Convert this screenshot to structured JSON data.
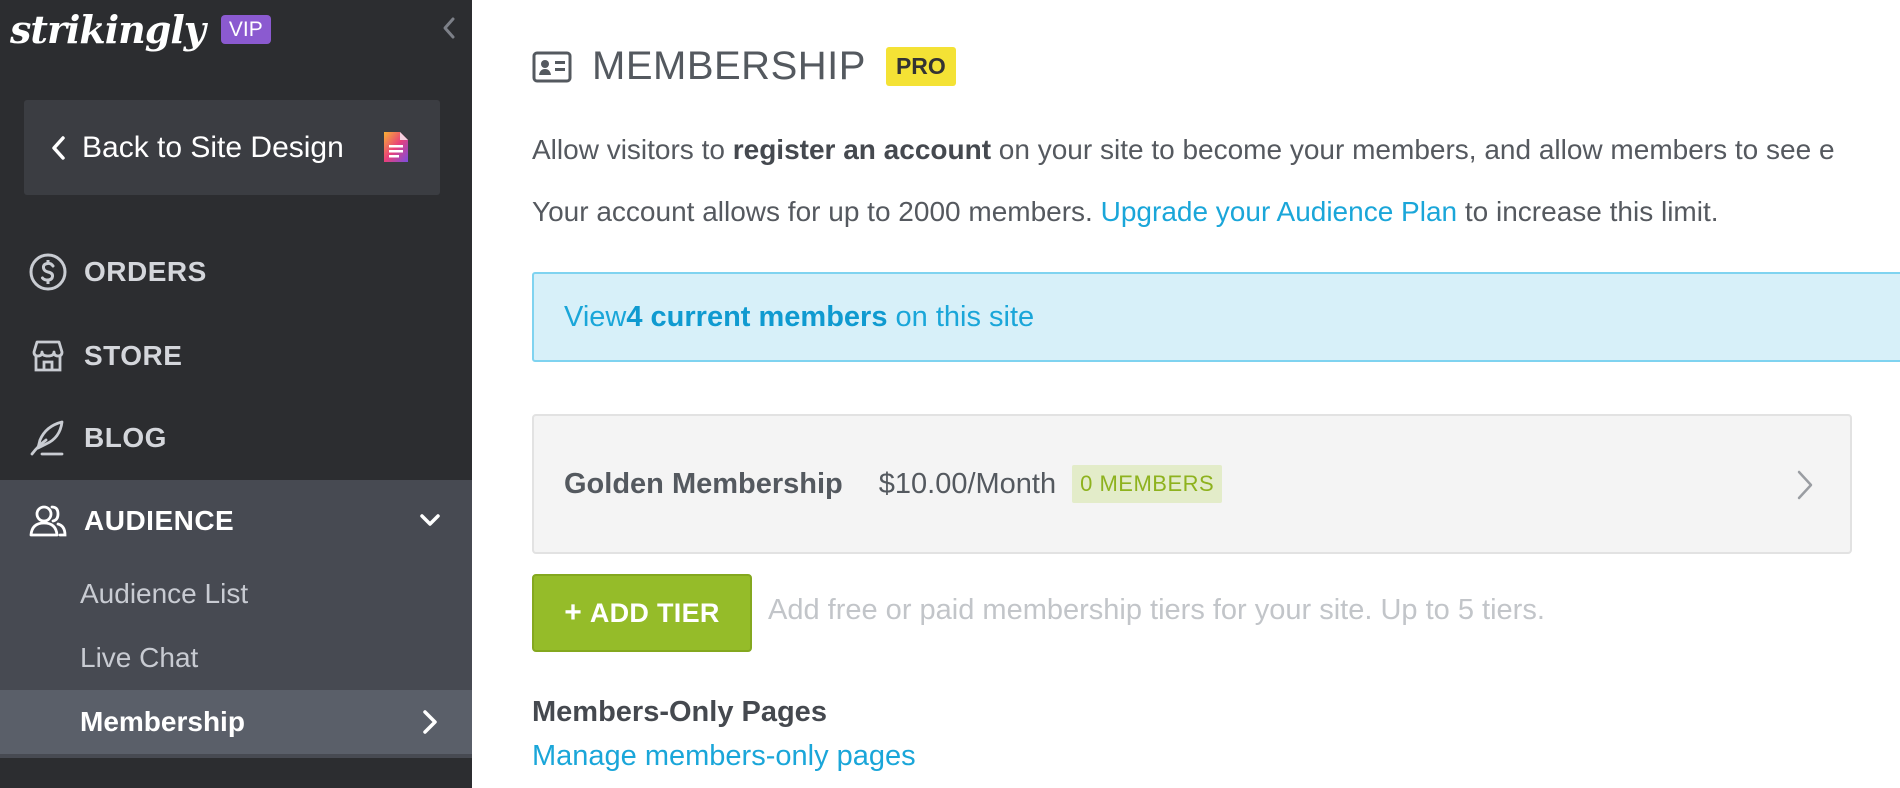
{
  "sidebar": {
    "logo": "strikingly",
    "vip": "VIP",
    "back_label": "Back to Site Design",
    "nav": [
      {
        "label": "ORDERS",
        "icon": "dollar-circle-icon"
      },
      {
        "label": "STORE",
        "icon": "storefront-icon"
      },
      {
        "label": "BLOG",
        "icon": "quill-icon"
      },
      {
        "label": "AUDIENCE",
        "icon": "users-icon"
      }
    ],
    "subnav": [
      {
        "label": "Audience List"
      },
      {
        "label": "Live Chat"
      },
      {
        "label": "Membership"
      }
    ]
  },
  "main": {
    "title": "MEMBERSHIP",
    "pro": "PRO",
    "desc1_pre": "Allow visitors to ",
    "desc1_bold": "register an account",
    "desc1_post": " on your site to become your members, and allow members to see e",
    "desc2_pre": "Your account allows for up to 2000 members. ",
    "desc2_link": "Upgrade your Audience Plan",
    "desc2_post": " to increase this limit.",
    "info_pre": "View ",
    "info_bold": "4 current members",
    "info_post": " on this site",
    "tier": {
      "name": "Golden Membership",
      "price": "$10.00/Month",
      "members": "0 MEMBERS"
    },
    "add_tier_label": "ADD TIER",
    "add_tier_hint": "Add free or paid membership tiers for your site. Up to 5 tiers.",
    "section_title": "Members-Only Pages",
    "section_link": "Manage members-only pages"
  },
  "colors": {
    "sidebar_bg": "#2c2d30",
    "active_bg": "#474a52",
    "link": "#1aa6d9",
    "green": "#95bc29",
    "pro_yellow": "#f4e235",
    "vip_purple": "#8b5ad0"
  }
}
